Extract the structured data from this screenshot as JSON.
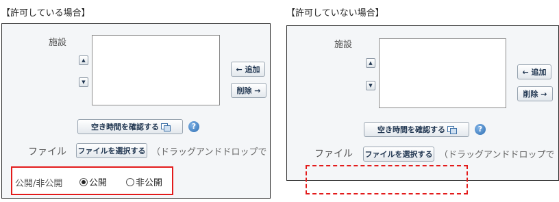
{
  "left": {
    "heading": "【許可している場合】",
    "facility_label": "施設",
    "up_arrow": "▲",
    "down_arrow": "▼",
    "add_button": "← 追加",
    "remove_button": "削除 →",
    "check_availability_button": "空き時間を確認する",
    "help_icon": "?",
    "file_label": "ファイル",
    "select_file_button": "ファイルを選択する",
    "drag_drop_text": "（ドラッグアンドドロップで",
    "visibility_label": "公開/非公開",
    "public_option": "公開",
    "private_option": "非公開",
    "public_selected": true
  },
  "right": {
    "heading": "【許可していない場合】",
    "facility_label": "施設",
    "up_arrow": "▲",
    "down_arrow": "▼",
    "add_button": "← 追加",
    "remove_button": "削除 →",
    "check_availability_button": "空き時間を確認する",
    "help_icon": "?",
    "file_label": "ファイル",
    "select_file_button": "ファイルを選択する",
    "drag_drop_text": "（ドラッグアンドドロップで"
  },
  "colors": {
    "highlight_red": "#e31b1b",
    "panel_bg": "#f4f6f8",
    "button_text": "#1f3550"
  }
}
